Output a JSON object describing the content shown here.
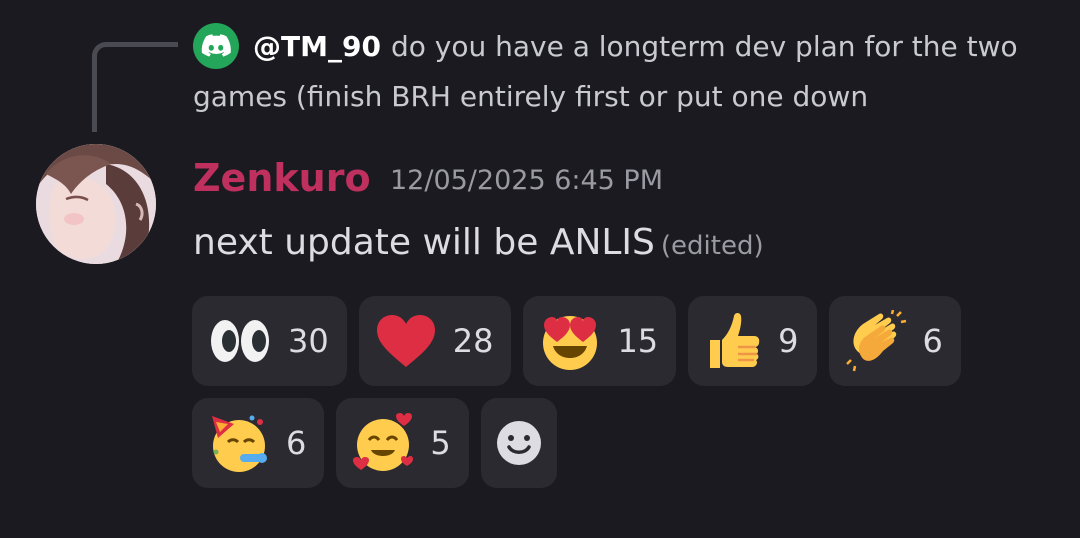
{
  "reply": {
    "author": "@TM_90",
    "text": "do you have a longterm dev plan for the two games (finish BRH entirely first or put one down",
    "avatar_icon": "discord-logo-icon",
    "avatar_color": "#23a55a"
  },
  "message": {
    "author": "Zenkuro",
    "author_color": "#c0305e",
    "timestamp": "12/05/2025 6:45 PM",
    "text": "next update will be ANLIS",
    "edited_label": "(edited)"
  },
  "reactions": [
    {
      "icon": "eyes-emoji-icon",
      "count": "30"
    },
    {
      "icon": "red-heart-emoji-icon",
      "count": "28"
    },
    {
      "icon": "heart-eyes-emoji-icon",
      "count": "15"
    },
    {
      "icon": "thumbs-up-emoji-icon",
      "count": "9"
    },
    {
      "icon": "clapping-hands-emoji-icon",
      "count": "6"
    },
    {
      "icon": "partying-face-emoji-icon",
      "count": "6"
    },
    {
      "icon": "smiling-face-with-hearts-emoji-icon",
      "count": "5"
    }
  ],
  "add_reaction_icon": "add-reaction-smiley-icon"
}
